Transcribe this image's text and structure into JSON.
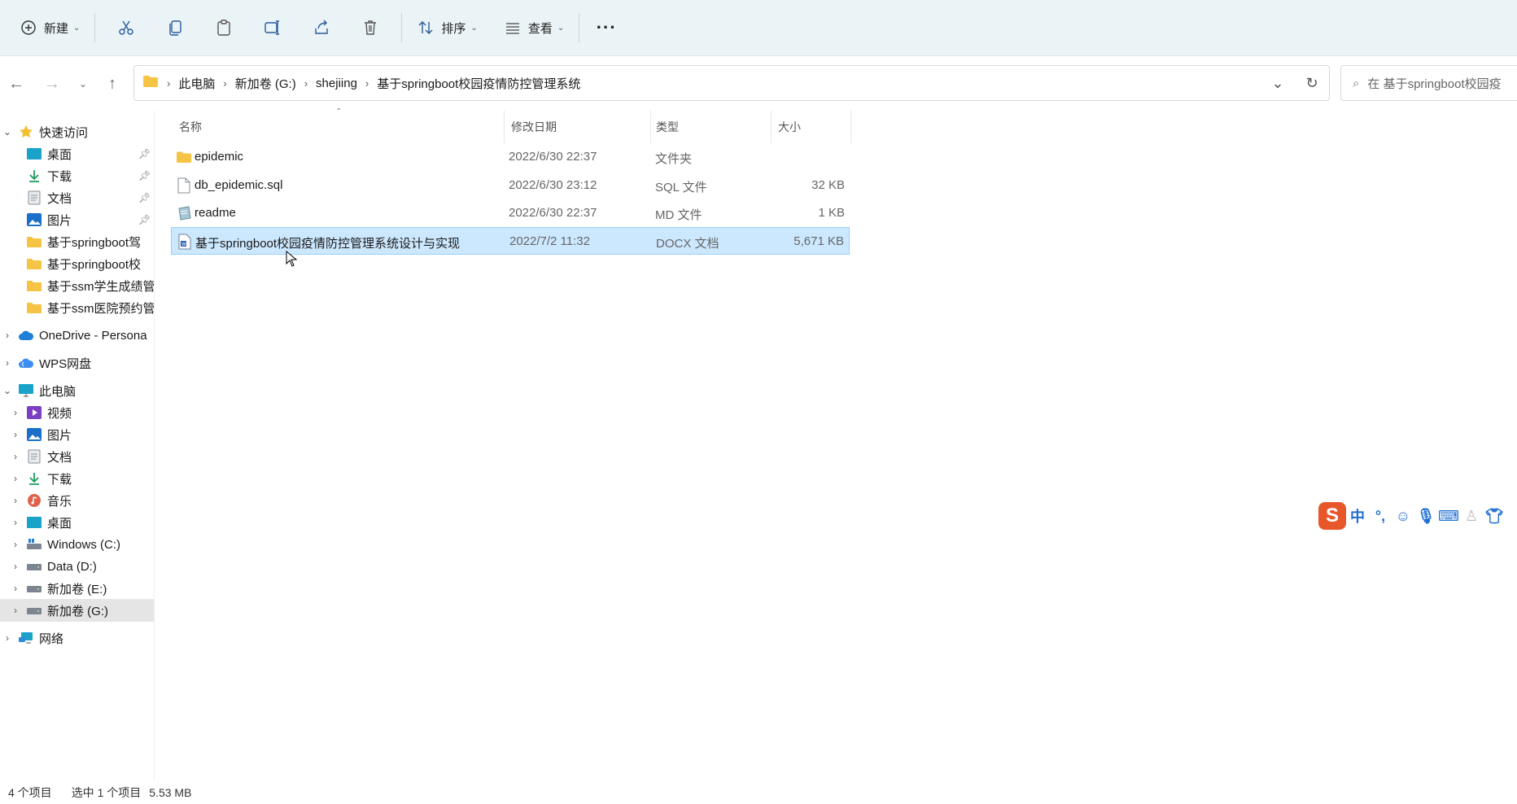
{
  "toolbar": {
    "new_label": "新建",
    "sort_label": "排序",
    "view_label": "查看",
    "more_label": "···"
  },
  "address": {
    "crumbs": [
      "此电脑",
      "新加卷 (G:)",
      "shejiing",
      "基于springboot校园疫情防控管理系统"
    ]
  },
  "search": {
    "placeholder": "在 基于springboot校园疫"
  },
  "sidebar": {
    "quick_access": "快速访问",
    "quick_items": [
      {
        "label": "桌面",
        "icon": "desktop-icon"
      },
      {
        "label": "下载",
        "icon": "download-icon"
      },
      {
        "label": "文档",
        "icon": "document-icon"
      },
      {
        "label": "图片",
        "icon": "pictures-icon"
      },
      {
        "label": "基于springboot驾",
        "icon": "folder-icon"
      },
      {
        "label": "基于springboot校",
        "icon": "folder-icon"
      },
      {
        "label": "基于ssm学生成绩管",
        "icon": "folder-icon"
      },
      {
        "label": "基于ssm医院预约管",
        "icon": "folder-icon"
      }
    ],
    "onedrive": "OneDrive - Persona",
    "wps": "WPS网盘",
    "this_pc": "此电脑",
    "pc_items": [
      {
        "label": "视频",
        "icon": "video-icon"
      },
      {
        "label": "图片",
        "icon": "pictures-icon"
      },
      {
        "label": "文档",
        "icon": "document-icon"
      },
      {
        "label": "下载",
        "icon": "download-icon"
      },
      {
        "label": "音乐",
        "icon": "music-icon"
      },
      {
        "label": "桌面",
        "icon": "desktop-icon"
      },
      {
        "label": "Windows (C:)",
        "icon": "drive-icon"
      },
      {
        "label": "Data (D:)",
        "icon": "drive-icon"
      },
      {
        "label": "新加卷 (E:)",
        "icon": "drive-icon"
      },
      {
        "label": "新加卷 (G:)",
        "icon": "drive-icon"
      }
    ],
    "network": "网络"
  },
  "columns": {
    "name": "名称",
    "date": "修改日期",
    "type": "类型",
    "size": "大小"
  },
  "files": [
    {
      "name": "epidemic",
      "date": "2022/6/30 22:37",
      "type": "文件夹",
      "size": "",
      "icon": "folder-icon"
    },
    {
      "name": "db_epidemic.sql",
      "date": "2022/6/30 23:12",
      "type": "SQL 文件",
      "size": "32 KB",
      "icon": "file-icon"
    },
    {
      "name": "readme",
      "date": "2022/6/30 22:37",
      "type": "MD 文件",
      "size": "1 KB",
      "icon": "markdown-icon"
    },
    {
      "name": "基于springboot校园疫情防控管理系统设计与实现",
      "date": "2022/7/2 11:32",
      "type": "DOCX 文档",
      "size": "5,671 KB",
      "icon": "word-doc-icon"
    }
  ],
  "status": {
    "count": "4 个项目",
    "selected": "选中 1 个项目",
    "size": "5.53 MB"
  },
  "ime": {
    "logo": "S",
    "lang": "中"
  },
  "colors": {
    "toolbar_bg": "#eaf3f6",
    "selection_bg": "#cce8ff",
    "folder_yellow": "#f5c445"
  }
}
